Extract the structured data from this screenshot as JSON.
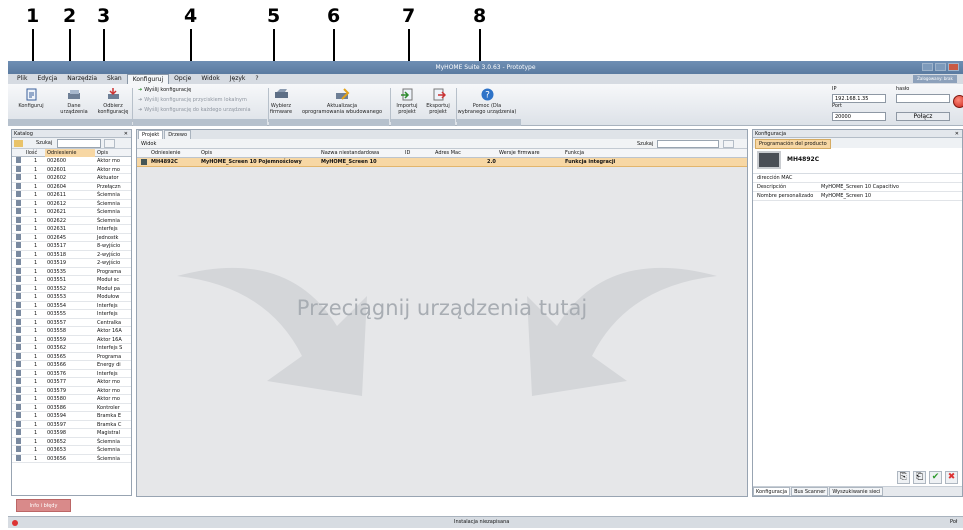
{
  "callouts": [
    "1",
    "2",
    "3",
    "4",
    "5",
    "6",
    "7",
    "8"
  ],
  "window": {
    "title": "MyHOME Suite 3.0.63 - Prototype"
  },
  "menu": [
    "Plik",
    "Edycja",
    "Narzędzia",
    "Skan",
    "Konfiguruj",
    "Opcje",
    "Widok",
    "Język",
    "?"
  ],
  "login_label": "Zalogowany: brak",
  "ribbon": {
    "konfiguruj": "Konfiguruj",
    "dane": [
      "Dane",
      "urządzenia"
    ],
    "odbierz": [
      "Odbierz",
      "konfigurację"
    ],
    "send": [
      "Wyślij konfigurację",
      "Wyślij konfigurację przyciskiem lokalnym",
      "Wyślij konfigurację do każdego urządzenia"
    ],
    "wybierz": [
      "Wybierz",
      "firmware"
    ],
    "aktualizacja": [
      "Aktualizacja",
      "oprogramowania wbudowanego"
    ],
    "import": [
      "Importuj",
      "projekt"
    ],
    "eksport": [
      "Eksportuj",
      "projekt"
    ],
    "pomoc": [
      "Pomoc (Dla",
      "wybranego urządzenia)"
    ]
  },
  "connection": {
    "ip_label": "IP",
    "ip_value": "192.168.1.35",
    "haslo_label": "hasło",
    "port_label": "Port",
    "port_value": "20000",
    "connect": "Połącz"
  },
  "catalog": {
    "title": "Katalog",
    "search": "Szukaj",
    "cols": [
      "Ilość",
      "Odniesienie",
      "Opis"
    ],
    "rows": [
      [
        "1",
        "002600",
        "Aktor mo"
      ],
      [
        "1",
        "002601",
        "Aktor mo"
      ],
      [
        "1",
        "002602",
        "Aktuator"
      ],
      [
        "1",
        "002604",
        "Przełączn"
      ],
      [
        "1",
        "002611",
        "Ściemnia"
      ],
      [
        "1",
        "002612",
        "Ściemnia"
      ],
      [
        "1",
        "002621",
        "Ściemnia"
      ],
      [
        "1",
        "002622",
        "Ściemnia"
      ],
      [
        "1",
        "002631",
        "Interfejs"
      ],
      [
        "1",
        "002645",
        "Jednostk"
      ],
      [
        "1",
        "003517",
        "8-wyjścio"
      ],
      [
        "1",
        "003518",
        "2-wyjścio"
      ],
      [
        "1",
        "003519",
        "2-wyjścio"
      ],
      [
        "1",
        "003535",
        "Programa"
      ],
      [
        "1",
        "003551",
        "Moduł sc"
      ],
      [
        "1",
        "003552",
        "Moduł pa"
      ],
      [
        "1",
        "003553",
        "Modułow"
      ],
      [
        "1",
        "003554",
        "Interfejs"
      ],
      [
        "1",
        "003555",
        "Interfejs"
      ],
      [
        "1",
        "003557",
        "Centralka"
      ],
      [
        "1",
        "003558",
        "Aktor 16A"
      ],
      [
        "1",
        "003559",
        "Aktor 16A"
      ],
      [
        "1",
        "003562",
        "Interfejs S"
      ],
      [
        "1",
        "003565",
        "Programa"
      ],
      [
        "1",
        "003566",
        "Energy di"
      ],
      [
        "1",
        "003576",
        "Interfejs"
      ],
      [
        "1",
        "003577",
        "Aktor mo"
      ],
      [
        "1",
        "003579",
        "Aktor mo"
      ],
      [
        "1",
        "003580",
        "Aktor mo"
      ],
      [
        "1",
        "003586",
        "Kontroler"
      ],
      [
        "1",
        "003594",
        "Bramka E"
      ],
      [
        "1",
        "003597",
        "Bramka C"
      ],
      [
        "1",
        "003598",
        "Magistral"
      ],
      [
        "1",
        "003652",
        "Ściemnia"
      ],
      [
        "1",
        "003653",
        "Ściemnia"
      ],
      [
        "1",
        "003656",
        "Ściemnia"
      ]
    ]
  },
  "info_tab": "Info i błędy",
  "project": {
    "tabs": [
      "Projekt",
      "Drzewo"
    ],
    "widok": "Widok",
    "search": "Szukaj",
    "cols": [
      "Odniesienie",
      "Opis",
      "Nazwa niestandardowa",
      "ID",
      "Adres Mac",
      "Wersje firmware",
      "Funkcja"
    ],
    "row": [
      "MH4892C",
      "MyHOME_Screen 10 Pojemnościowy",
      "MyHOME_Screen 10",
      "",
      "",
      "2.0",
      "Funkcja integracji"
    ],
    "drop_text": "Przeciągnij urządzenia tutaj"
  },
  "config": {
    "title": "Konfiguracja",
    "tab": "Programación del producto",
    "product": "MH4892C",
    "rows": [
      [
        "dirección MAC",
        ""
      ],
      [
        "Descripción",
        "MyHOME_Screen 10 Capacitivo"
      ],
      [
        "Nombre personalizado",
        "MyHOME_Screen 10"
      ]
    ],
    "bottom_tabs": [
      "Konfiguracja",
      "Bus Scanner",
      "Wyszukiwanie sieci"
    ]
  },
  "status": {
    "center": "Instalacja niezapisana",
    "right": "Poł"
  }
}
